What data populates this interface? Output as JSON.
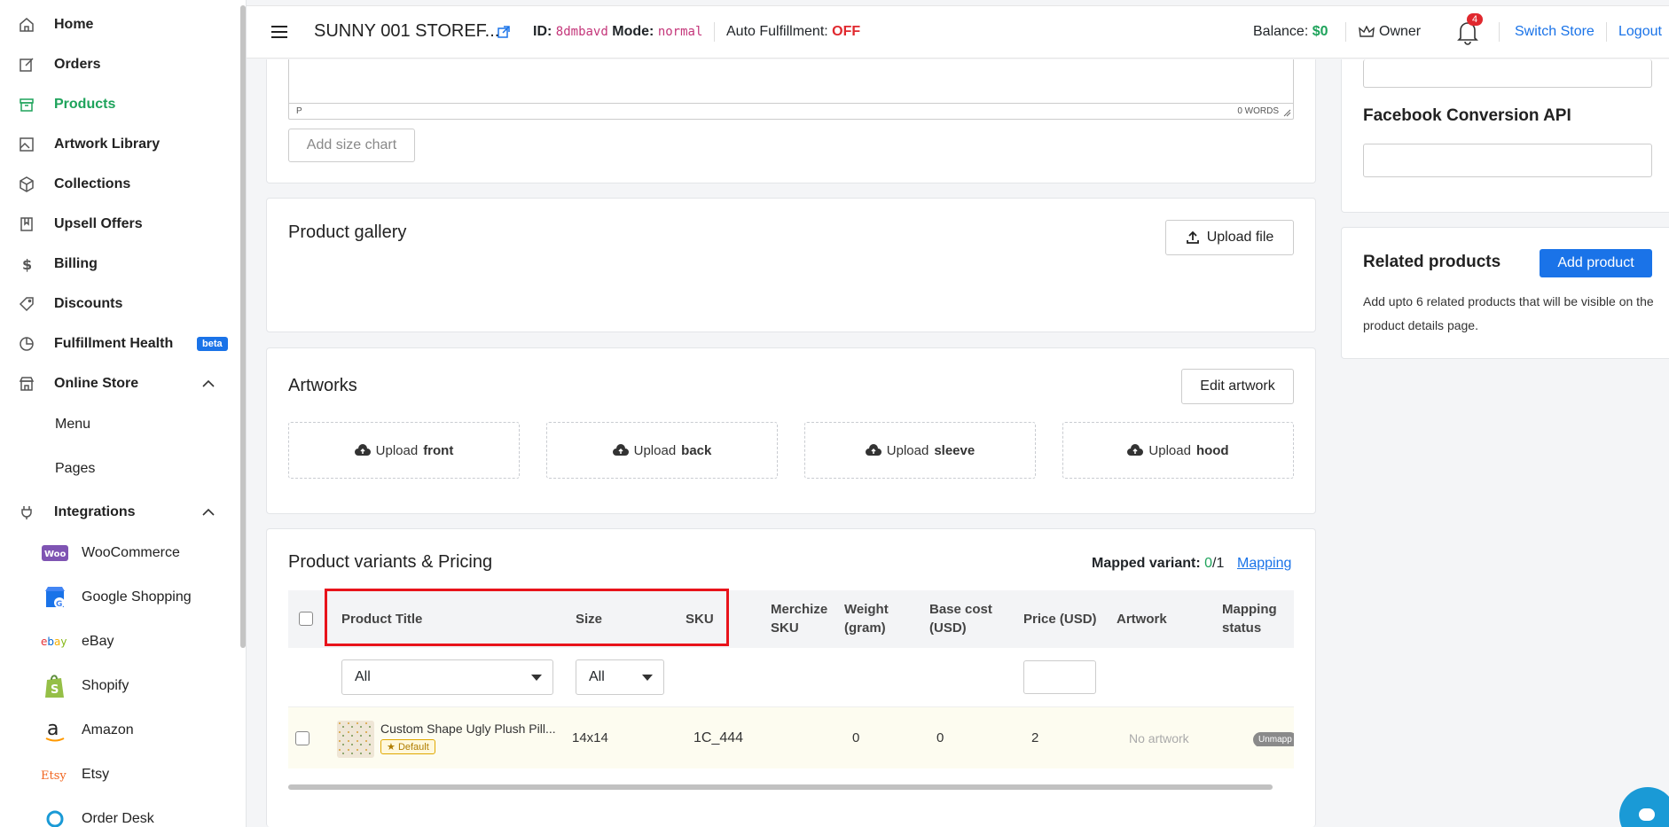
{
  "topbar": {
    "store_name": "SUNNY 001 STOREF...",
    "id_label": "ID:",
    "id_value": "8dmbavd",
    "mode_label": "Mode:",
    "mode_value": "normal",
    "auto_label": "Auto Fulfillment:",
    "auto_value": "OFF",
    "balance_label": "Balance:",
    "balance_value": "$0",
    "owner": "Owner",
    "notif_count": "4",
    "switch_store": "Switch Store",
    "logout": "Logout"
  },
  "sidebar": {
    "items": [
      {
        "label": "Home",
        "icon": "home-icon"
      },
      {
        "label": "Orders",
        "icon": "edit-icon"
      },
      {
        "label": "Products",
        "icon": "box-icon"
      },
      {
        "label": "Artwork Library",
        "icon": "image-icon"
      },
      {
        "label": "Collections",
        "icon": "cube-icon"
      },
      {
        "label": "Upsell Offers",
        "icon": "book-icon"
      },
      {
        "label": "Billing",
        "icon": "dollar-icon"
      },
      {
        "label": "Discounts",
        "icon": "tag-icon"
      },
      {
        "label": "Fulfillment Health",
        "icon": "pie-icon"
      },
      {
        "label": "Online Store",
        "icon": "store-icon"
      },
      {
        "label": "Integrations",
        "icon": "plug-icon"
      }
    ],
    "beta": "beta",
    "online_store_sub": [
      "Menu",
      "Pages"
    ],
    "integrations": [
      "WooCommerce",
      "Google Shopping",
      "eBay",
      "Shopify",
      "Amazon",
      "Etsy",
      "Order Desk"
    ]
  },
  "editor": {
    "path": "P",
    "words": "0 WORDS",
    "add_size_chart": "Add size chart"
  },
  "gallery": {
    "title": "Product gallery",
    "upload": "Upload file"
  },
  "artworks": {
    "title": "Artworks",
    "edit": "Edit artwork",
    "upload_prefix": "Upload",
    "sides": [
      "front",
      "back",
      "sleeve",
      "hood"
    ]
  },
  "variants": {
    "title": "Product variants & Pricing",
    "mapped_label": "Mapped variant:",
    "mapped_value": "0",
    "mapped_total": "/1",
    "mapping_link": "Mapping",
    "headers": {
      "product_title": "Product Title",
      "size": "Size",
      "sku": "SKU",
      "merchize_sku": "Merchize SKU",
      "weight": "Weight (gram)",
      "base_cost": "Base cost (USD)",
      "price": "Price (USD)",
      "artwork": "Artwork",
      "mapping_status": "Mapping status"
    },
    "filters": {
      "title": "All",
      "size": "All"
    },
    "row": {
      "title": "Custom Shape Ugly Plush Pill...",
      "default_badge": "Default",
      "size": "14x14",
      "sku": "1C_444",
      "weight": "0",
      "base_cost": "0",
      "price": "2",
      "artwork": "No artwork",
      "status": "Unmapp"
    }
  },
  "right": {
    "fb_title": "Facebook Conversion API",
    "related_title": "Related products",
    "add_product": "Add product",
    "related_desc": "Add upto 6 related products that will be visible on the product details page."
  }
}
